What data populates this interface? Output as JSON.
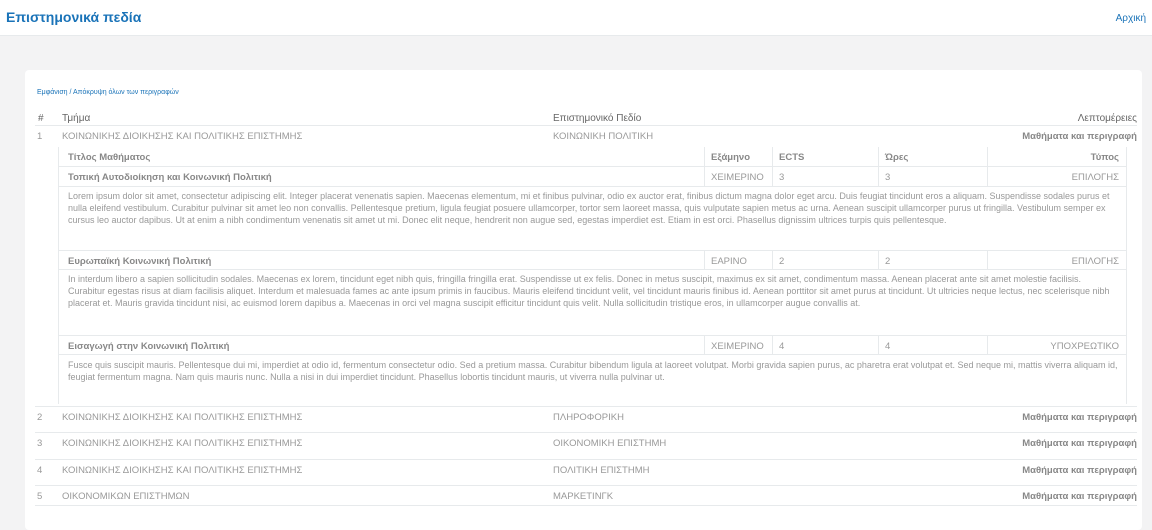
{
  "header": {
    "title": "Επιστημονικά πεδία",
    "home": "Αρχική"
  },
  "toggle_all": "Εμφάνιση / Απόκρυψη όλων των περιγραφών",
  "columns": {
    "num": "#",
    "dept": "Τμήμα",
    "field": "Επιστημονικό Πεδίο",
    "details": "Λεπτομέρειες"
  },
  "courses_header": {
    "title": "Τίτλος Μαθήματος",
    "semester": "Εξάμηνο",
    "ects": "ECTS",
    "hours": "Ώρες",
    "type": "Τύπος"
  },
  "rows": [
    {
      "num": "1",
      "dept": "ΚΟΙΝΩΝΙΚΗΣ ΔΙΟΙΚΗΣΗΣ ΚΑΙ ΠΟΛΙΤΙΚΗΣ ΕΠΙΣΤΗΜΗΣ",
      "field": "ΚΟΙΝΩΝΙΚΗ ΠΟΛΙΤΙΚΗ",
      "details": "Μαθήματα και περιγραφή"
    },
    {
      "num": "2",
      "dept": "ΚΟΙΝΩΝΙΚΗΣ ΔΙΟΙΚΗΣΗΣ ΚΑΙ ΠΟΛΙΤΙΚΗΣ ΕΠΙΣΤΗΜΗΣ",
      "field": "ΠΛΗΡΟΦΟΡΙΚΗ",
      "details": "Μαθήματα και περιγραφή"
    },
    {
      "num": "3",
      "dept": "ΚΟΙΝΩΝΙΚΗΣ ΔΙΟΙΚΗΣΗΣ ΚΑΙ ΠΟΛΙΤΙΚΗΣ ΕΠΙΣΤΗΜΗΣ",
      "field": "ΟΙΚΟΝΟΜΙΚΗ ΕΠΙΣΤΗΜΗ",
      "details": "Μαθήματα και περιγραφή"
    },
    {
      "num": "4",
      "dept": "ΚΟΙΝΩΝΙΚΗΣ ΔΙΟΙΚΗΣΗΣ ΚΑΙ ΠΟΛΙΤΙΚΗΣ ΕΠΙΣΤΗΜΗΣ",
      "field": "ΠΟΛΙΤΙΚΗ ΕΠΙΣΤΗΜΗ",
      "details": "Μαθήματα και περιγραφή"
    },
    {
      "num": "5",
      "dept": "ΟΙΚΟΝΟΜΙΚΩΝ ΕΠΙΣΤΗΜΩΝ",
      "field": "ΜΑΡΚΕΤΙΝΓΚ",
      "details": "Μαθήματα και περιγραφή"
    }
  ],
  "courses": [
    {
      "title": "Τοπική Αυτοδιοίκηση και Κοινωνική Πολιτική",
      "semester": "ΧΕΙΜΕΡΙΝΟ",
      "ects": "3",
      "hours": "3",
      "type": "ΕΠΙΛΟΓΗΣ",
      "description": "Lorem ipsum dolor sit amet, consectetur adipiscing elit. Integer placerat venenatis sapien. Maecenas elementum, mi et finibus pulvinar, odio ex auctor erat, finibus dictum magna dolor eget arcu. Duis feugiat tincidunt eros a aliquam. Suspendisse sodales purus et nulla eleifend vestibulum. Curabitur pulvinar sit amet leo non convallis. Pellentesque pretium, ligula feugiat posuere ullamcorper, tortor sem laoreet massa, quis vulputate sapien metus ac urna. Aenean suscipit ullamcorper purus ut fringilla. Vestibulum semper ex cursus leo auctor dapibus. Ut at enim a nibh condimentum venenatis sit amet ut mi. Donec elit neque, hendrerit non augue sed, egestas imperdiet est. Etiam in est orci. Phasellus dignissim ultrices turpis quis pellentesque."
    },
    {
      "title": "Ευρωπαϊκή Κοινωνική Πολιτική",
      "semester": "ΕΑΡΙΝΟ",
      "ects": "2",
      "hours": "2",
      "type": "ΕΠΙΛΟΓΗΣ",
      "description": "In interdum libero a sapien sollicitudin sodales. Maecenas ex lorem, tincidunt eget nibh quis, fringilla fringilla erat. Suspendisse ut ex felis. Donec in metus suscipit, maximus ex sit amet, condimentum massa. Aenean placerat ante sit amet molestie facilisis. Curabitur egestas risus at diam facilisis aliquet. Interdum et malesuada fames ac ante ipsum primis in faucibus. Mauris eleifend tincidunt velit, vel tincidunt mauris finibus id. Aenean porttitor sit amet purus at tincidunt. Ut ultricies neque lectus, nec scelerisque nibh placerat et. Mauris gravida tincidunt nisi, ac euismod lorem dapibus a. Maecenas in orci vel magna suscipit efficitur tincidunt quis velit. Nulla sollicitudin tristique eros, in ullamcorper augue convallis at."
    },
    {
      "title": "Εισαγωγή στην Κοινωνική Πολιτική",
      "semester": "ΧΕΙΜΕΡΙΝΟ",
      "ects": "4",
      "hours": "4",
      "type": "ΥΠΟΧΡΕΩΤΙΚΟ",
      "description": "Fusce quis suscipit mauris. Pellentesque dui mi, imperdiet at odio id, fermentum consectetur odio. Sed a pretium massa. Curabitur bibendum ligula at laoreet volutpat. Morbi gravida sapien purus, ac pharetra erat volutpat et. Sed neque mi, mattis viverra aliquam id, feugiat fermentum magna. Nam quis mauris nunc. Nulla a nisi in dui imperdiet tincidunt. Phasellus lobortis tincidunt mauris, ut viverra nulla pulvinar ut."
    }
  ]
}
